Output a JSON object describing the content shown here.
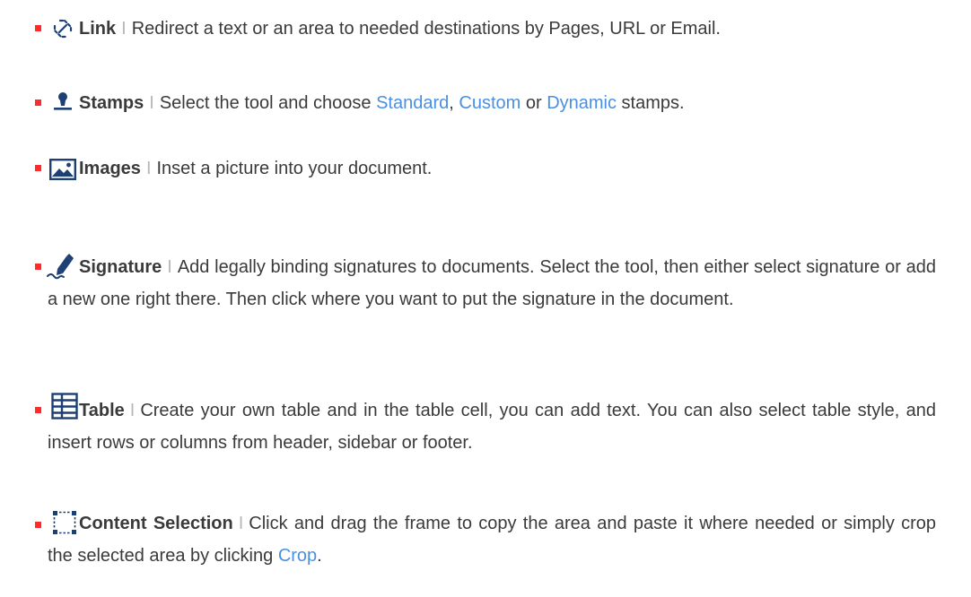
{
  "colors": {
    "bullet": "#ff2a2a",
    "icon": "#1d3f73",
    "link": "#4a90e2",
    "separator": "#b8b8b8"
  },
  "items": [
    {
      "icon": "link-icon",
      "title": "Link",
      "sep": "I",
      "text": "Redirect a text or an area to needed destinations by Pages, URL or Email."
    },
    {
      "icon": "stamp-icon",
      "title": "Stamps",
      "sep": "I",
      "text_a": "Select the tool and choose ",
      "link_standard": "Standard",
      "text_b": ", ",
      "link_custom": "Custom",
      "text_c": " or ",
      "link_dynamic": "Dynamic",
      "text_d": " stamps."
    },
    {
      "icon": "image-icon",
      "title": "Images",
      "sep": "I",
      "text": "Inset a picture into your document."
    },
    {
      "icon": "signature-icon",
      "title": "Signature",
      "sep": "I",
      "text": "Add legally binding signatures to documents. Select the tool, then either select signature or add a new one right there. Then click where you want to put the signature in the document."
    },
    {
      "icon": "table-icon",
      "title": "Table",
      "sep": "I",
      "text": "Create your own table and in the table cell, you can add text. You can also select table style, and insert rows or columns from header, sidebar or footer."
    },
    {
      "icon": "content-selection-icon",
      "title": "Content Selection",
      "sep": "I",
      "text_a": "Click and drag the frame to copy the area and paste it where needed or simply crop the selected area by clicking ",
      "link_crop": "Crop",
      "text_b": "."
    }
  ]
}
